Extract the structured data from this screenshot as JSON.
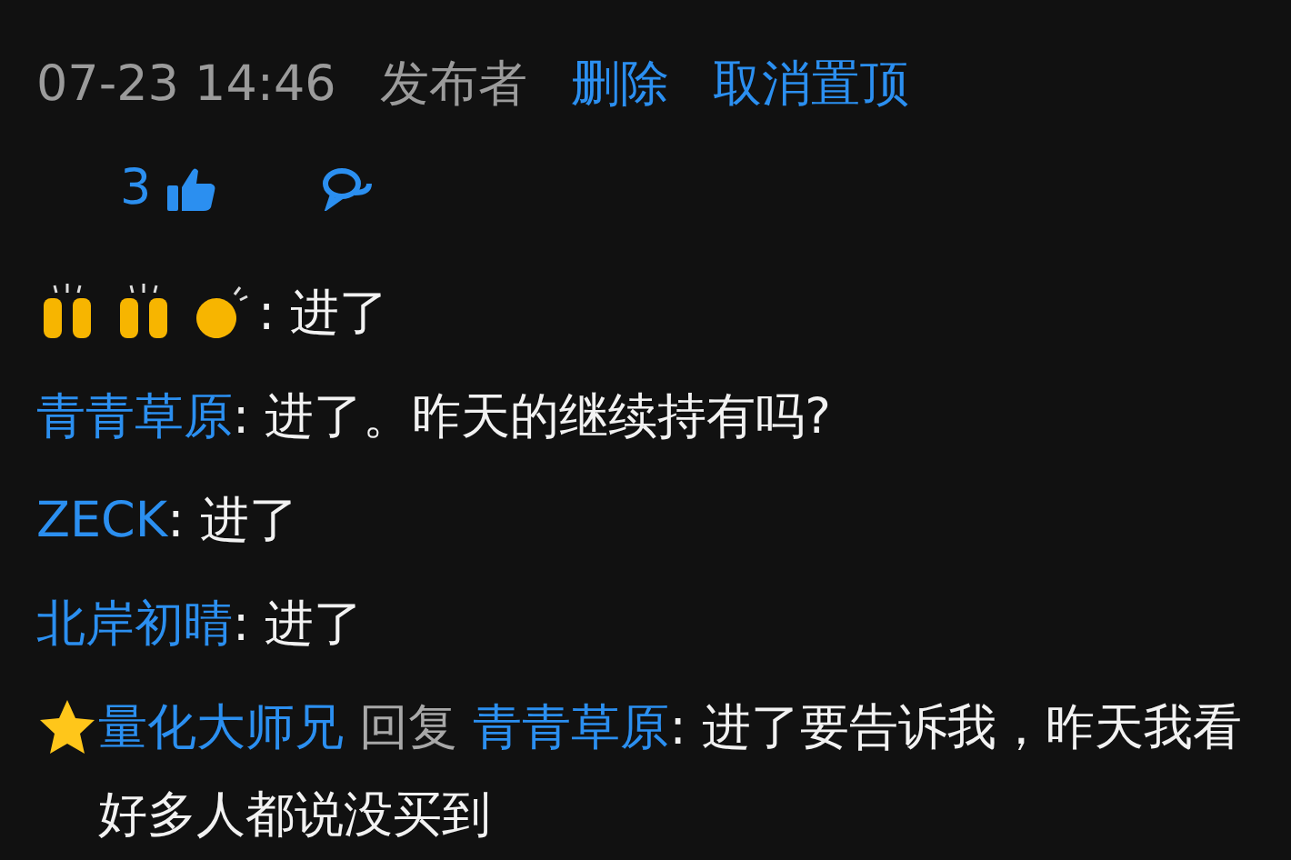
{
  "post_meta": {
    "time": "07-23 14:46",
    "author_label": "发布者",
    "actions": [
      "删除",
      "取消置顶"
    ]
  },
  "stats": {
    "likes": "3"
  },
  "comments": [
    {
      "kind": "emoji",
      "text": ": 进了"
    },
    {
      "kind": "plain",
      "author": "青青草原",
      "text": ": 进了。昨天的继续持有吗?"
    },
    {
      "kind": "plain",
      "author": "ZECK",
      "text": ": 进了"
    },
    {
      "kind": "plain",
      "author": "北岸初晴",
      "text": ": 进了"
    },
    {
      "kind": "starred",
      "author": "量化大师兄",
      "reply_label": "回复",
      "reply_to": "青青草原",
      "text": ": 进了要告诉我，昨天我看好多人都说没买到"
    }
  ]
}
